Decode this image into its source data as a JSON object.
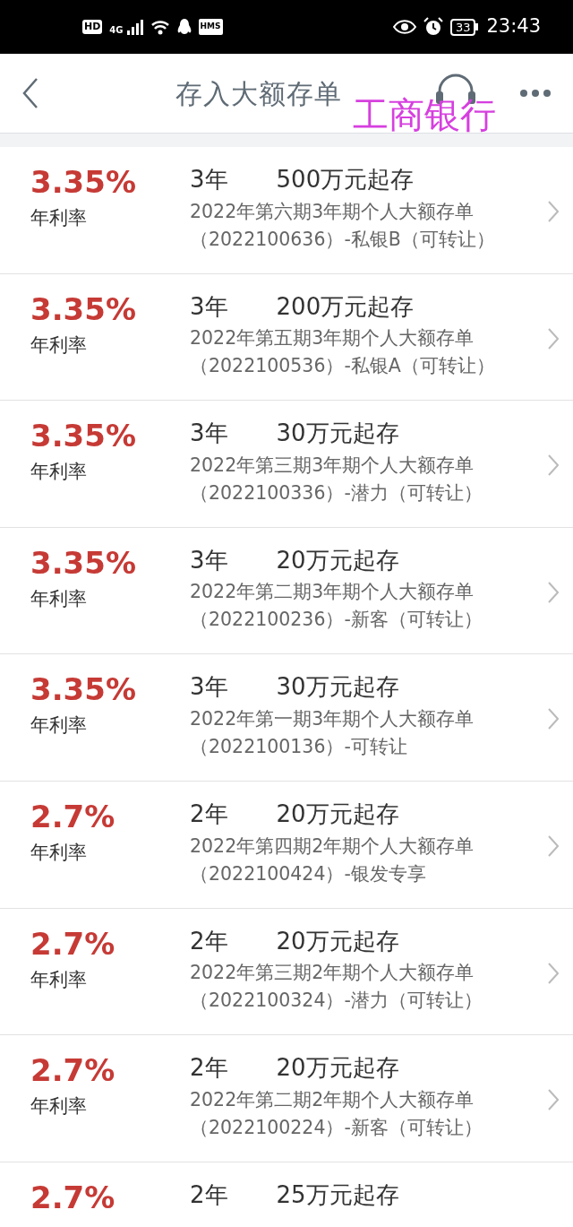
{
  "status_bar": {
    "hd": "HD",
    "network": "4G",
    "hms": "HMS",
    "battery": "33",
    "time": "23:43"
  },
  "header": {
    "title": "存入大额存单",
    "annotation": "工商银行"
  },
  "products": [
    {
      "rate": "3.35%",
      "rate_label": "年利率",
      "term": "3年",
      "minimum": "500万元起存",
      "name": "2022年第六期3年期个人大额存单",
      "code": "（2022100636）-私银B（可转让）"
    },
    {
      "rate": "3.35%",
      "rate_label": "年利率",
      "term": "3年",
      "minimum": "200万元起存",
      "name": "2022年第五期3年期个人大额存单",
      "code": "（2022100536）-私银A（可转让）"
    },
    {
      "rate": "3.35%",
      "rate_label": "年利率",
      "term": "3年",
      "minimum": "30万元起存",
      "name": "2022年第三期3年期个人大额存单",
      "code": "（2022100336）-潜力（可转让）"
    },
    {
      "rate": "3.35%",
      "rate_label": "年利率",
      "term": "3年",
      "minimum": "20万元起存",
      "name": "2022年第二期3年期个人大额存单",
      "code": "（2022100236）-新客（可转让）"
    },
    {
      "rate": "3.35%",
      "rate_label": "年利率",
      "term": "3年",
      "minimum": "30万元起存",
      "name": "2022年第一期3年期个人大额存单",
      "code": "（2022100136）-可转让"
    },
    {
      "rate": "2.7%",
      "rate_label": "年利率",
      "term": "2年",
      "minimum": "20万元起存",
      "name": "2022年第四期2年期个人大额存单",
      "code": "（2022100424）-银发专享"
    },
    {
      "rate": "2.7%",
      "rate_label": "年利率",
      "term": "2年",
      "minimum": "20万元起存",
      "name": "2022年第三期2年期个人大额存单",
      "code": "（2022100324）-潜力（可转让）"
    },
    {
      "rate": "2.7%",
      "rate_label": "年利率",
      "term": "2年",
      "minimum": "20万元起存",
      "name": "2022年第二期2年期个人大额存单",
      "code": "（2022100224）-新客（可转让）"
    },
    {
      "rate": "2.7%",
      "term": "2年",
      "minimum": "25万元起存"
    }
  ]
}
